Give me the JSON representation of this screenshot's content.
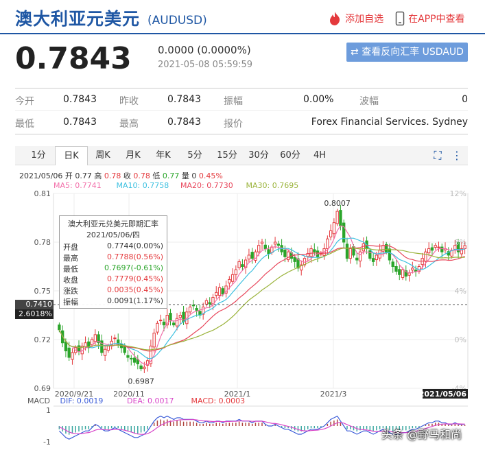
{
  "header": {
    "title": "澳大利亚元美元",
    "code": "(AUDUSD)",
    "add_fav": "添加自选",
    "open_app": "在APP中查看"
  },
  "quote": {
    "price": "0.7843",
    "change": "0.0000 (0.0000%)",
    "timestamp": "2021-05-08 05:59:59",
    "reverse_button": "查看反向汇率 USDAUD"
  },
  "stats": {
    "open_label": "今开",
    "open": "0.7843",
    "prev_label": "昨收",
    "prev": "0.7843",
    "amp_label": "振幅",
    "amp": "0.00%",
    "wave_label": "波幅",
    "wave": "0",
    "low_label": "最低",
    "low": "0.7843",
    "high_label": "最高",
    "high": "0.7843",
    "quote_label": "报价",
    "quote_src": "Forex Financial Services. Sydney"
  },
  "tabs": [
    "1分",
    "日K",
    "周K",
    "月K",
    "年K",
    "5分",
    "15分",
    "30分",
    "60分",
    "4H"
  ],
  "active_tab": "日K",
  "ohlc_line": {
    "date": "2021/05/06",
    "open_l": "开",
    "open": "0.77",
    "high_l": "高",
    "high": "0.78",
    "close_l": "收",
    "close": "0.78",
    "low_l": "低",
    "low": "0.77",
    "vol_l": "量",
    "vol": "0",
    "pct": "0.45%"
  },
  "ma_legend": [
    {
      "label": "MA5: 0.7741",
      "color": "#f26ea9"
    },
    {
      "label": "MA10: 0.7758",
      "color": "#3cc0e0"
    },
    {
      "label": "MA20: 0.7730",
      "color": "#e8455a"
    },
    {
      "label": "MA30: 0.7695",
      "color": "#9ab33a"
    }
  ],
  "tooltip": {
    "title": "澳大利亚元兑美元即期汇率",
    "date": "2021/05/06/四",
    "rows": [
      {
        "label": "开盘",
        "value": "0.7744(0.00%)",
        "color": "#333"
      },
      {
        "label": "最高",
        "value": "0.7788(0.56%)",
        "color": "#e4393c"
      },
      {
        "label": "最低",
        "value": "0.7697(-0.61%)",
        "color": "#2aa52a"
      },
      {
        "label": "收盘",
        "value": "0.7779(0.45%)",
        "color": "#e4393c"
      },
      {
        "label": "涨跌",
        "value": "0.0035(0.45%)",
        "color": "#e4393c"
      },
      {
        "label": "振幅",
        "value": "0.0091(1.17%)",
        "color": "#333"
      }
    ]
  },
  "crosshair": {
    "price": "0.7410",
    "pct": "2.6018%"
  },
  "macd_legend": {
    "macd_l": "MACD",
    "dif": "DIF: 0.0019",
    "dea": "DEA: 0.0017",
    "macd": "MACD: 0.0003"
  },
  "watermark": "头条 @野马和尚",
  "chart_data": {
    "type": "candlestick",
    "y_ticks": [
      "0.81",
      "0.78",
      "0.75",
      "0.72",
      "0.69"
    ],
    "ylim": [
      0.69,
      0.81
    ],
    "right_ticks": [
      "12%",
      "8%",
      "4%",
      "0%",
      "-4%"
    ],
    "x_ticks": [
      "2020/9/21",
      "2020/11",
      "2021/1",
      "2021/3",
      "2021/05/06"
    ],
    "annotations": [
      {
        "label": "0.8007",
        "value": 0.8007
      },
      {
        "label": "0.6987",
        "value": 0.6987
      }
    ],
    "macd_ticks": [
      "1",
      "-1"
    ],
    "closes": [
      0.726,
      0.718,
      0.713,
      0.709,
      0.712,
      0.715,
      0.713,
      0.716,
      0.718,
      0.715,
      0.72,
      0.723,
      0.718,
      0.712,
      0.714,
      0.716,
      0.719,
      0.721,
      0.717,
      0.715,
      0.712,
      0.709,
      0.708,
      0.706,
      0.705,
      0.702,
      0.703,
      0.707,
      0.716,
      0.724,
      0.73,
      0.732,
      0.729,
      0.735,
      0.732,
      0.729,
      0.733,
      0.735,
      0.731,
      0.737,
      0.74,
      0.741,
      0.738,
      0.735,
      0.74,
      0.744,
      0.742,
      0.746,
      0.749,
      0.752,
      0.748,
      0.753,
      0.757,
      0.76,
      0.763,
      0.768,
      0.765,
      0.769,
      0.772,
      0.77,
      0.774,
      0.778,
      0.78,
      0.776,
      0.773,
      0.777,
      0.78,
      0.778,
      0.774,
      0.771,
      0.774,
      0.77,
      0.768,
      0.764,
      0.766,
      0.77,
      0.773,
      0.776,
      0.774,
      0.771,
      0.773,
      0.776,
      0.782,
      0.787,
      0.792,
      0.799,
      0.79,
      0.78,
      0.77,
      0.776,
      0.772,
      0.769,
      0.774,
      0.779,
      0.776,
      0.77,
      0.768,
      0.772,
      0.775,
      0.778,
      0.774,
      0.769,
      0.765,
      0.762,
      0.76,
      0.763,
      0.759,
      0.761,
      0.764,
      0.762,
      0.765,
      0.77,
      0.774,
      0.776,
      0.775,
      0.778,
      0.777,
      0.774,
      0.776,
      0.772,
      0.775,
      0.778,
      0.774,
      0.776,
      0.7779
    ],
    "macd_hist": [
      -0.3,
      -0.5,
      -0.7,
      -0.8,
      -0.7,
      -0.6,
      -0.5,
      -0.4,
      -0.3,
      -0.3,
      -0.1,
      0.1,
      0.0,
      -0.2,
      -0.3,
      -0.3,
      -0.2,
      -0.1,
      -0.2,
      -0.3,
      -0.4,
      -0.5,
      -0.6,
      -0.7,
      -0.7,
      -0.6,
      -0.5,
      -0.3,
      0.0,
      0.3,
      0.5,
      0.6,
      0.5,
      0.6,
      0.5,
      0.4,
      0.5,
      0.5,
      0.4,
      0.4,
      0.4,
      0.4,
      0.3,
      0.2,
      0.2,
      0.3,
      0.2,
      0.2,
      0.3,
      0.3,
      0.2,
      0.3,
      0.3,
      0.3,
      0.3,
      0.4,
      0.3,
      0.3,
      0.3,
      0.2,
      0.3,
      0.3,
      0.3,
      0.1,
      0.0,
      0.0,
      0.1,
      0.0,
      -0.1,
      -0.2,
      -0.2,
      -0.3,
      -0.4,
      -0.5,
      -0.5,
      -0.4,
      -0.3,
      -0.2,
      -0.2,
      -0.2,
      -0.1,
      0.0,
      0.2,
      0.4,
      0.5,
      0.6,
      0.3,
      0.0,
      -0.3,
      -0.3,
      -0.4,
      -0.5,
      -0.4,
      -0.3,
      -0.3,
      -0.4,
      -0.5,
      -0.4,
      -0.3,
      -0.2,
      -0.3,
      -0.4,
      -0.5,
      -0.5,
      -0.5,
      -0.4,
      -0.4,
      -0.3,
      -0.2,
      -0.2,
      -0.1,
      0.0,
      0.1,
      0.2,
      0.2,
      0.3,
      0.3,
      0.2,
      0.2,
      0.1,
      0.1,
      0.2,
      0.1,
      0.1,
      0.1
    ]
  }
}
